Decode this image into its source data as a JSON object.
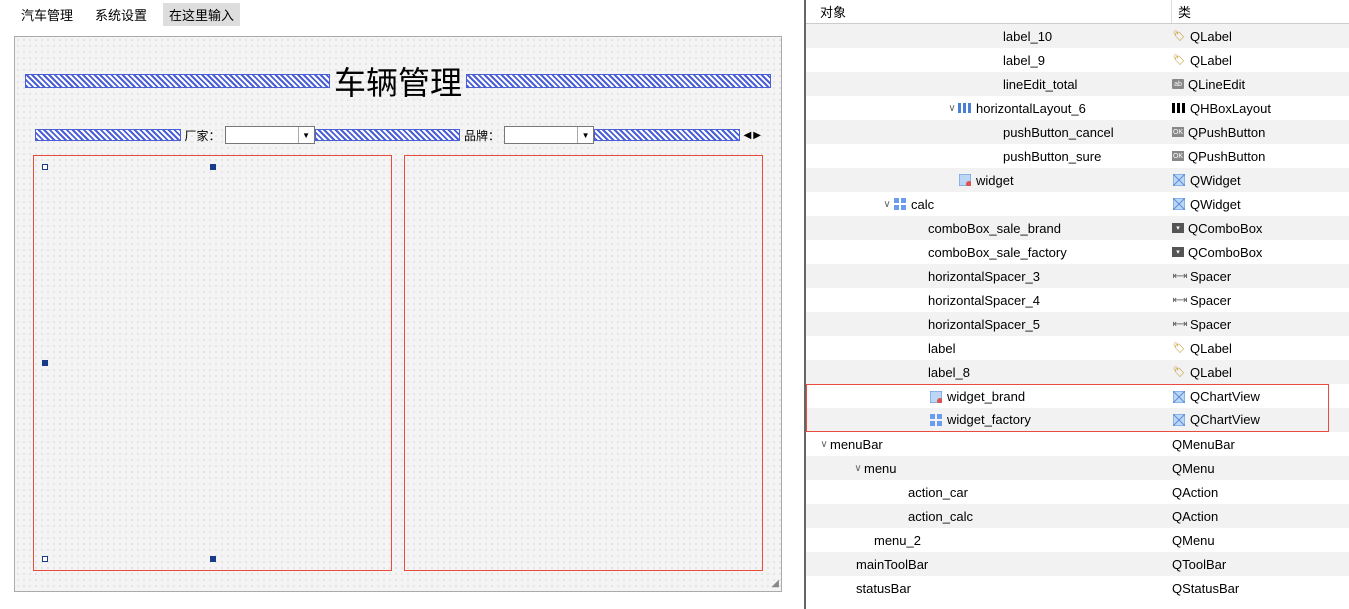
{
  "menubar": {
    "menu1": "汽车管理",
    "menu2": "系统设置",
    "typeHere": "在这里输入"
  },
  "designer": {
    "title": "车辆管理",
    "factoryLabel": "厂家：",
    "brandLabel": "品牌："
  },
  "header": {
    "object": "对象",
    "class": "类"
  },
  "tree": [
    {
      "indent": 185,
      "expander": "",
      "icon": "",
      "name": "label_10",
      "clsIcon": "tag",
      "cls": "QLabel",
      "alt": true
    },
    {
      "indent": 185,
      "expander": "",
      "icon": "",
      "name": "label_9",
      "clsIcon": "tag",
      "cls": "QLabel",
      "alt": false
    },
    {
      "indent": 185,
      "expander": "",
      "icon": "",
      "name": "lineEdit_total",
      "clsIcon": "edit",
      "cls": "QLineEdit",
      "alt": true
    },
    {
      "indent": 140,
      "expander": "∨",
      "icon": "layout",
      "name": "horizontalLayout_6",
      "clsIcon": "layout",
      "cls": "QHBoxLayout",
      "alt": false
    },
    {
      "indent": 185,
      "expander": "",
      "icon": "",
      "name": "pushButton_cancel",
      "clsIcon": "btn",
      "cls": "QPushButton",
      "alt": true
    },
    {
      "indent": 185,
      "expander": "",
      "icon": "",
      "name": "pushButton_sure",
      "clsIcon": "btn",
      "cls": "QPushButton",
      "alt": false
    },
    {
      "indent": 140,
      "expander": "",
      "icon": "widget-red",
      "name": "widget",
      "clsIcon": "widget",
      "cls": "QWidget",
      "alt": true
    },
    {
      "indent": 75,
      "expander": "∨",
      "icon": "grid",
      "name": "calc",
      "clsIcon": "widget",
      "cls": "QWidget",
      "alt": false
    },
    {
      "indent": 110,
      "expander": "",
      "icon": "",
      "name": "comboBox_sale_brand",
      "clsIcon": "combo",
      "cls": "QComboBox",
      "alt": true
    },
    {
      "indent": 110,
      "expander": "",
      "icon": "",
      "name": "comboBox_sale_factory",
      "clsIcon": "combo",
      "cls": "QComboBox",
      "alt": false
    },
    {
      "indent": 110,
      "expander": "",
      "icon": "",
      "name": "horizontalSpacer_3",
      "clsIcon": "spacer",
      "cls": "Spacer",
      "alt": true
    },
    {
      "indent": 110,
      "expander": "",
      "icon": "",
      "name": "horizontalSpacer_4",
      "clsIcon": "spacer",
      "cls": "Spacer",
      "alt": false
    },
    {
      "indent": 110,
      "expander": "",
      "icon": "",
      "name": "horizontalSpacer_5",
      "clsIcon": "spacer",
      "cls": "Spacer",
      "alt": true
    },
    {
      "indent": 110,
      "expander": "",
      "icon": "",
      "name": "label",
      "clsIcon": "tag",
      "cls": "QLabel",
      "alt": false
    },
    {
      "indent": 110,
      "expander": "",
      "icon": "",
      "name": "label_8",
      "clsIcon": "tag",
      "cls": "QLabel",
      "alt": true
    },
    {
      "indent": 110,
      "expander": "",
      "icon": "widget-red",
      "name": "widget_brand",
      "clsIcon": "widget",
      "cls": "QChartView",
      "alt": false,
      "hl": "top"
    },
    {
      "indent": 110,
      "expander": "",
      "icon": "grid",
      "name": "widget_factory",
      "clsIcon": "widget",
      "cls": "QChartView",
      "alt": true,
      "hl": "bottom"
    },
    {
      "indent": 12,
      "expander": "∨",
      "icon": "",
      "name": "menuBar",
      "clsIcon": "",
      "cls": "QMenuBar",
      "alt": false
    },
    {
      "indent": 46,
      "expander": "∨",
      "icon": "",
      "name": "menu",
      "clsIcon": "",
      "cls": "QMenu",
      "alt": true
    },
    {
      "indent": 90,
      "expander": "",
      "icon": "",
      "name": "action_car",
      "clsIcon": "",
      "cls": "QAction",
      "alt": false
    },
    {
      "indent": 90,
      "expander": "",
      "icon": "",
      "name": "action_calc",
      "clsIcon": "",
      "cls": "QAction",
      "alt": true
    },
    {
      "indent": 56,
      "expander": "",
      "icon": "",
      "name": "menu_2",
      "clsIcon": "",
      "cls": "QMenu",
      "alt": false
    },
    {
      "indent": 38,
      "expander": "",
      "icon": "",
      "name": "mainToolBar",
      "clsIcon": "",
      "cls": "QToolBar",
      "alt": true
    },
    {
      "indent": 38,
      "expander": "",
      "icon": "",
      "name": "statusBar",
      "clsIcon": "",
      "cls": "QStatusBar",
      "alt": false
    }
  ]
}
